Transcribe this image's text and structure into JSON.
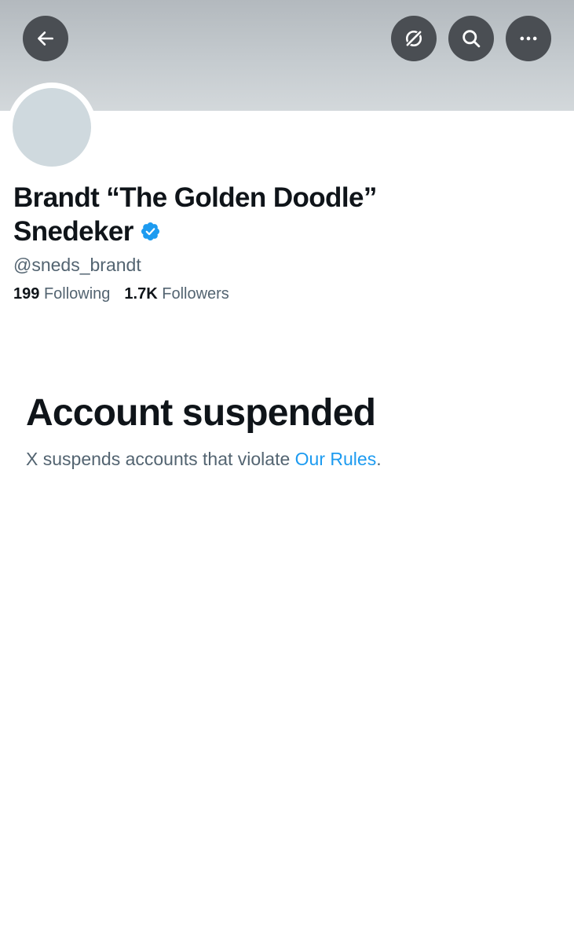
{
  "profile": {
    "display_name": "Brandt “The Golden Doodle” Snedeker",
    "handle": "@sneds_brandt",
    "following_count": "199",
    "following_label": "Following",
    "followers_count": "1.7K",
    "followers_label": "Followers",
    "verified": true
  },
  "toolbar": {
    "back_icon": "arrow-left-icon",
    "grok_icon": "grok-icon",
    "search_icon": "search-icon",
    "more_icon": "more-horizontal-icon"
  },
  "suspension": {
    "title": "Account suspended",
    "message_prefix": "X suspends accounts that violate ",
    "rules_link": "Our Rules",
    "message_suffix": "."
  },
  "colors": {
    "banner": "#c5cbcf",
    "button_bg": "#4a4e53",
    "avatar_placeholder": "#cfd9de",
    "text_primary": "#0f1419",
    "text_secondary": "#536471",
    "link": "#1d9bf0",
    "verified": "#1d9bf0"
  }
}
